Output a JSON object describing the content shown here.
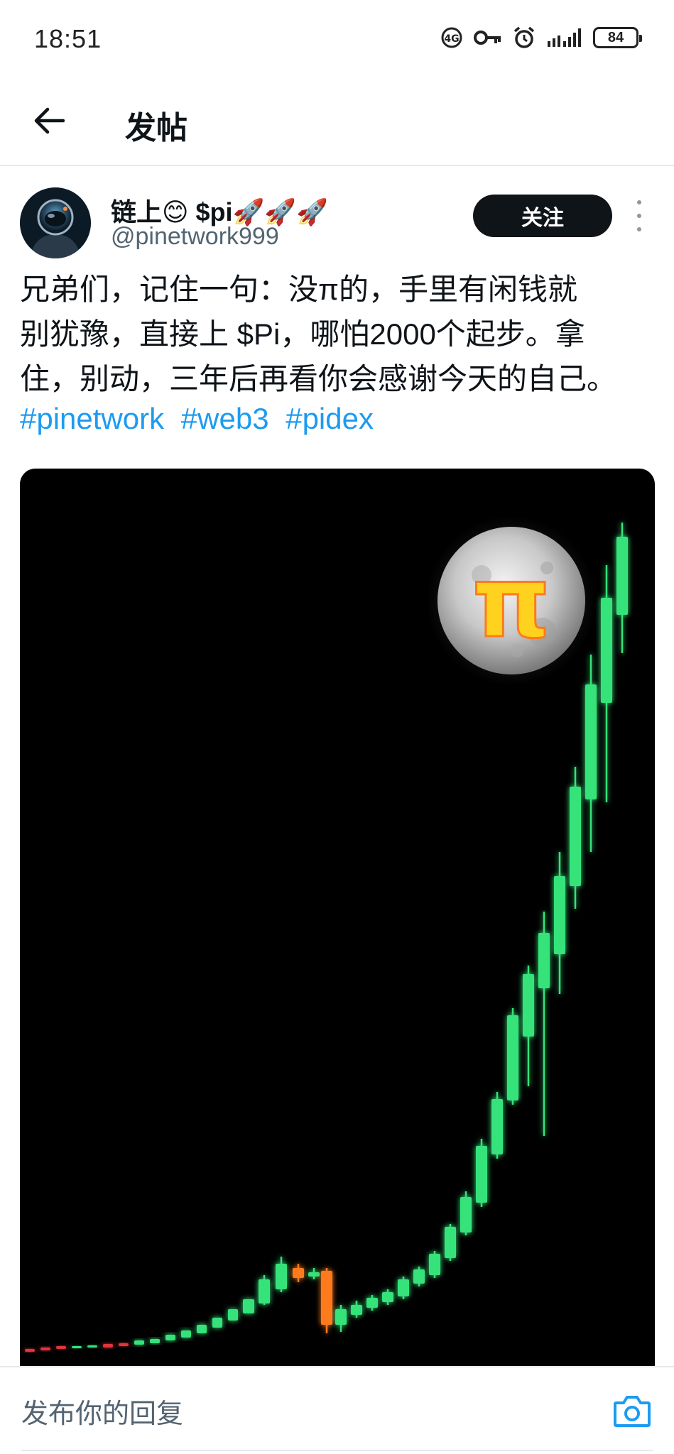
{
  "status_bar": {
    "time": "18:51",
    "battery": "84",
    "icons": [
      "volte-icon",
      "key-icon",
      "alarm-icon",
      "signal-icon"
    ]
  },
  "header": {
    "title": "发帖"
  },
  "post": {
    "author_name": "链上😊 $pi🚀🚀🚀",
    "author_handle": "@pinetwork999",
    "follow_label": "关注",
    "text_lines": [
      "兄弟们，记住一句：没π的，手里有闲钱就",
      "别犹豫，直接上 $Pi，哪怕2000个起步。拿",
      "住，别动，三年后再看你会感谢今天的自己。"
    ],
    "hashtags": [
      "#pinetwork",
      "#web3",
      "#pidex"
    ],
    "media": {
      "logo_text": "π",
      "colors": {
        "up": "#34e37a",
        "down": "#ff7a1a",
        "bearish_small": "#e0343a",
        "coin": "#ffd21f"
      }
    }
  },
  "reply": {
    "placeholder": "发布你的回复"
  }
}
